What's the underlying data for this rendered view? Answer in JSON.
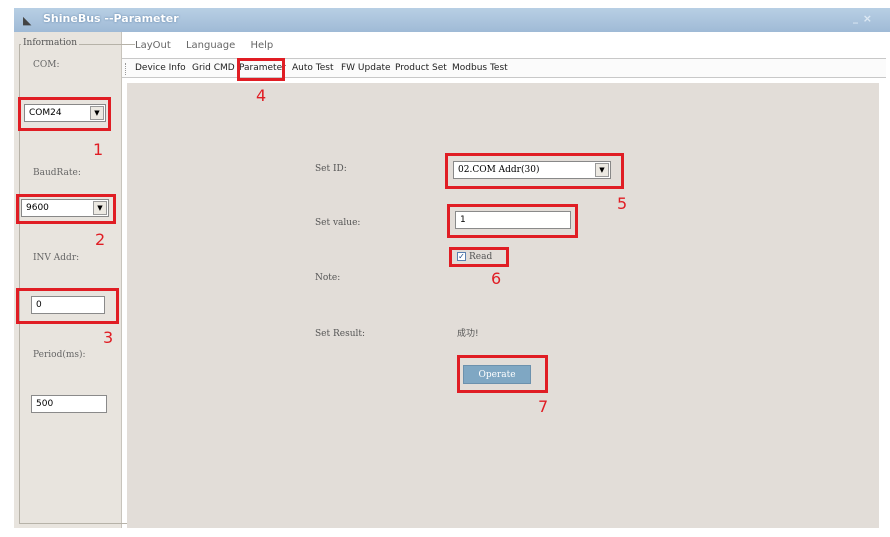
{
  "window": {
    "title": "ShineBus --Parameter",
    "minimize_glyph": "_",
    "close_glyph": "×"
  },
  "left": {
    "group_title": "Information",
    "com_label": "COM:",
    "com_value": "COM24",
    "baud_label": "BaudRate:",
    "baud_value": "9600",
    "inv_label": "INV Addr:",
    "inv_value": "0",
    "period_label": "Period(ms):",
    "period_value": "500"
  },
  "menu": [
    "LayOut",
    "Language",
    "Help"
  ],
  "tabs": [
    "Device Info",
    "Grid CMD",
    "Parameter",
    "Auto Test",
    "FW Update",
    "Product Set",
    "Modbus Test"
  ],
  "form": {
    "set_id_label": "Set ID:",
    "set_id_value": "02.COM Addr(30)",
    "set_value_label": "Set value:",
    "set_value_value": "1",
    "read_label": "Read",
    "read_checked": true,
    "note_label": "Note:",
    "result_label": "Set Result:",
    "result_value": "成功!",
    "operate_label": "Operate"
  },
  "annotations": [
    "1",
    "2",
    "3",
    "4",
    "5",
    "6",
    "7"
  ],
  "colors": {
    "annotation": "#e01d24",
    "titlebar": "#a9c2dc",
    "main_bg": "#e2ddd8",
    "button": "#7fa7c3"
  }
}
